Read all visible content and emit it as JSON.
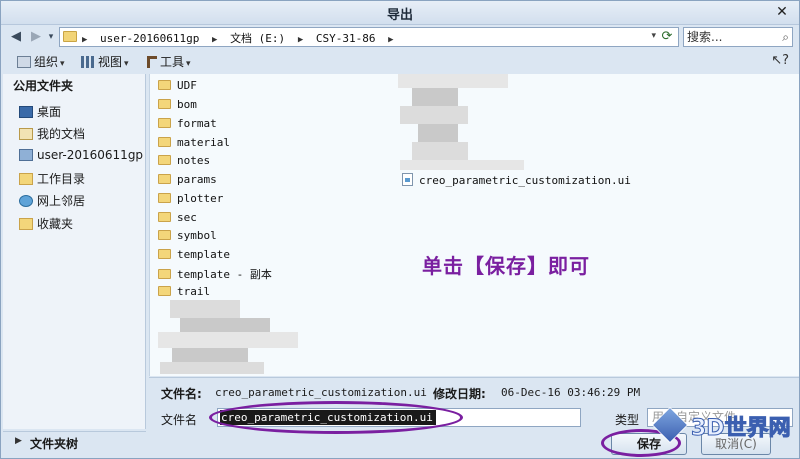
{
  "window": {
    "title": "导出"
  },
  "address": {
    "crumbs": [
      "user-20160611gp",
      "文档 (E:)",
      "CSY-31-86"
    ]
  },
  "search": {
    "placeholder": "搜索..."
  },
  "toolbar": {
    "organize": "组织",
    "views": "视图",
    "tools": "工具"
  },
  "nav": {
    "header": "公用文件夹",
    "items": [
      "桌面",
      "我的文档",
      "user-20160611gp",
      "工作目录",
      "网上邻居",
      "收藏夹"
    ],
    "folder_tree": "文件夹树"
  },
  "files": {
    "folders": [
      "UDF",
      "bom",
      "format",
      "material",
      "notes",
      "params",
      "plotter",
      "sec",
      "symbol",
      "template",
      "template - 副本",
      "trail"
    ],
    "right_files": [
      "creo_parametric_customization.ui"
    ]
  },
  "annotation": "单击【保存】即可",
  "details": {
    "name_label": "文件名:",
    "name_value": "creo_parametric_customization.ui",
    "date_label": "修改日期:",
    "date_value": "06-Dec-16 03:46:29 PM"
  },
  "save_form": {
    "filename_label": "文件名",
    "filename_value": "creo_parametric_customization.ui",
    "type_label": "类型",
    "type_value": "用户自定义文件",
    "save_button": "保存",
    "cancel_button": "取消(C)"
  },
  "watermark": {
    "text": "3D世界网"
  },
  "colors": {
    "annotation": "#7a1fa0",
    "window_bg": "#dbe6f2"
  }
}
